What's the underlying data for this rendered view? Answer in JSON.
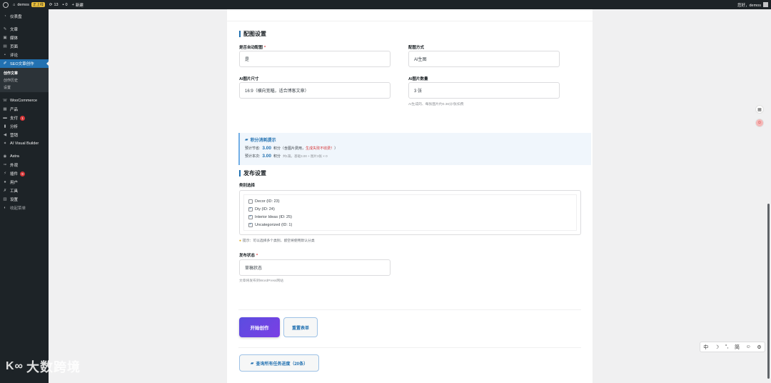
{
  "adminbar": {
    "site": "demos",
    "badge": "正上线",
    "updates": "13",
    "comments": "0",
    "new": "新建",
    "greeting": "您好，demos"
  },
  "sidebar": {
    "items": [
      {
        "label": "仪表盘",
        "icon": "dashboard-icon"
      },
      {
        "label": "文章",
        "icon": "pin-icon"
      },
      {
        "label": "媒体",
        "icon": "media-icon"
      },
      {
        "label": "页面",
        "icon": "page-icon"
      },
      {
        "label": "评论",
        "icon": "comment-icon"
      },
      {
        "label": "SEO文章创作",
        "icon": "pen-icon"
      }
    ],
    "submenu": [
      "创作文章",
      "创作历史",
      "设置"
    ],
    "items2": [
      {
        "label": "WooCommerce",
        "icon": "woo-icon"
      },
      {
        "label": "产品",
        "icon": "product-icon"
      },
      {
        "label": "支付",
        "icon": "payment-icon",
        "badge": "1"
      },
      {
        "label": "分析",
        "icon": "chart-icon"
      },
      {
        "label": "营销",
        "icon": "megaphone-icon"
      },
      {
        "label": "AI Visual Builder",
        "icon": "builder-icon"
      }
    ],
    "items3": [
      {
        "label": "Astra",
        "icon": "astra-icon"
      },
      {
        "label": "外观",
        "icon": "brush-icon"
      },
      {
        "label": "插件",
        "icon": "plugin-icon",
        "badge": "9"
      },
      {
        "label": "用户",
        "icon": "user-icon"
      },
      {
        "label": "工具",
        "icon": "wrench-icon"
      },
      {
        "label": "设置",
        "icon": "settings-icon"
      },
      {
        "label": "收起菜单",
        "icon": "collapse-icon"
      }
    ]
  },
  "image_settings": {
    "title": "配图设置",
    "auto_image_label": "是否自动配图",
    "auto_image_value": "是",
    "method_label": "配图方式",
    "method_value": "AI生图",
    "size_label": "AI图片尺寸",
    "size_value": "16:9（横向宽幅，适合博客文章）",
    "count_label": "AI图片数量",
    "count_value": "3 张",
    "count_hint": "AI生成的、每张图片约0.36分/张扣费"
  },
  "credits": {
    "title": "积分消耗提示",
    "estimate_label": "预计节省:",
    "estimate_value": "3.00",
    "estimate_note": "积分（含图片费用，",
    "estimate_warn": "生成失败不收费！",
    "estimate_end": "）",
    "cost_label": "预计本次:",
    "cost_value": "3.00",
    "cost_note": "积分",
    "cost_detail": "共1篇，基础3.00 + 图片3张 × 0"
  },
  "publish": {
    "title": "发布设置",
    "category_label": "类别选择",
    "categories": [
      {
        "label": "Decor (ID: 23)",
        "checked": ""
      },
      {
        "label": "Diy (ID: 24)",
        "checked": "✓"
      },
      {
        "label": "Interior Ideas (ID: 25)",
        "checked": "✓"
      },
      {
        "label": "Uncategorized (ID: 1)",
        "checked": "✓"
      }
    ],
    "category_hint": "提示：可以选择多个类别，留空将使用默认分类",
    "status_label": "发布状态",
    "status_value": "草稿状态",
    "status_hint": "文章将发布到WordPress网站"
  },
  "actions": {
    "start": "开始创作",
    "reset": "重置表单",
    "query": "查询所有任务进度（20条）"
  },
  "floating": {
    "ime": [
      "中",
      "☽",
      "°,",
      "简",
      "☺",
      "⚙"
    ]
  },
  "watermark": "大数跨境"
}
